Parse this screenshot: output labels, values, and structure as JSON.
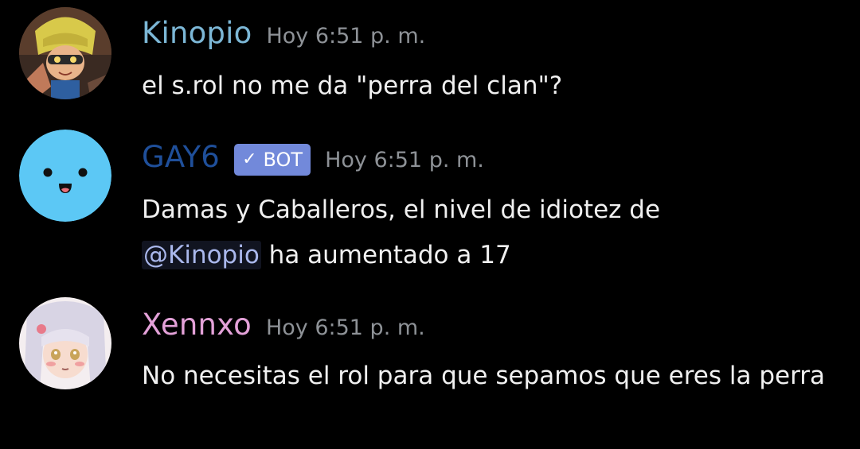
{
  "messages": [
    {
      "username": "Kinopio",
      "username_color": "#7cb7d6",
      "timestamp": "Hoy 6:51 p. m.",
      "text": "el s.rol no me da \"perra del clan\"?"
    },
    {
      "username": "GAY6",
      "username_color": "#1f4f9a",
      "bot_label": "BOT",
      "bot_check": "✓",
      "timestamp": "Hoy 6:51 p. m.",
      "text_before": "Damas y Caballeros, el nivel de idiotez de ",
      "mention": "@Kinopio",
      "text_after": " ha aumentado a 17"
    },
    {
      "username": "Xennxo",
      "username_color": "#e3a1d8",
      "timestamp": "Hoy 6:51 p. m.",
      "text": "No necesitas el rol para que sepamos que eres la perra"
    }
  ],
  "colors": {
    "background": "#000000",
    "timestamp": "#8e9297",
    "bot_tag": "#7289da",
    "gay6_avatar": "#5cc8f5"
  },
  "icons": [
    "kinopio-avatar-icon",
    "gay6-avatar-face-icon",
    "xennxo-avatar-icon",
    "checkmark-icon"
  ]
}
